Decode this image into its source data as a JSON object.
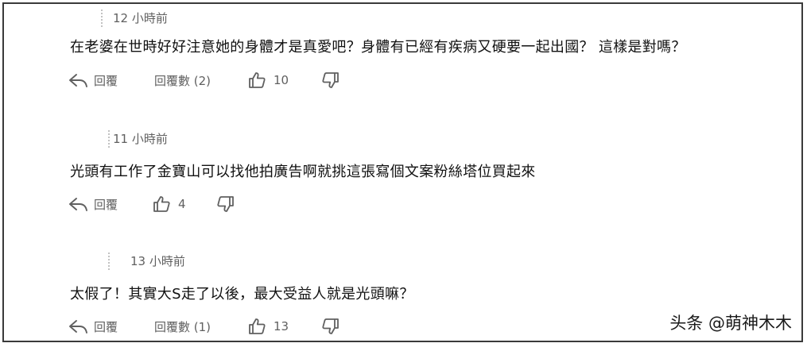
{
  "comments": [
    {
      "time": "12 小時前",
      "text": "在老婆在世時好好注意她的身體才是真愛吧？身體有已經有疾病又硬要一起出國？ 這樣是對嗎？",
      "reply_label": "回覆",
      "replies_label": "回覆數 (2)",
      "likes": "10"
    },
    {
      "time": "11 小時前",
      "text": "光頭有工作了金寶山可以找他拍廣告啊就挑這張寫個文案粉絲塔位買起來",
      "reply_label": "回覆",
      "likes": "4"
    },
    {
      "time": "13 小時前",
      "text": "太假了！其實大S走了以後，最大受益人就是光頭嘛？",
      "reply_label": "回覆",
      "replies_label": "回覆數 (1)",
      "likes": "13"
    }
  ],
  "watermark": "头条 @萌神木木",
  "icons": {
    "reply": "reply-arrow-icon",
    "like": "thumbs-up-icon",
    "dislike": "thumbs-down-icon"
  }
}
